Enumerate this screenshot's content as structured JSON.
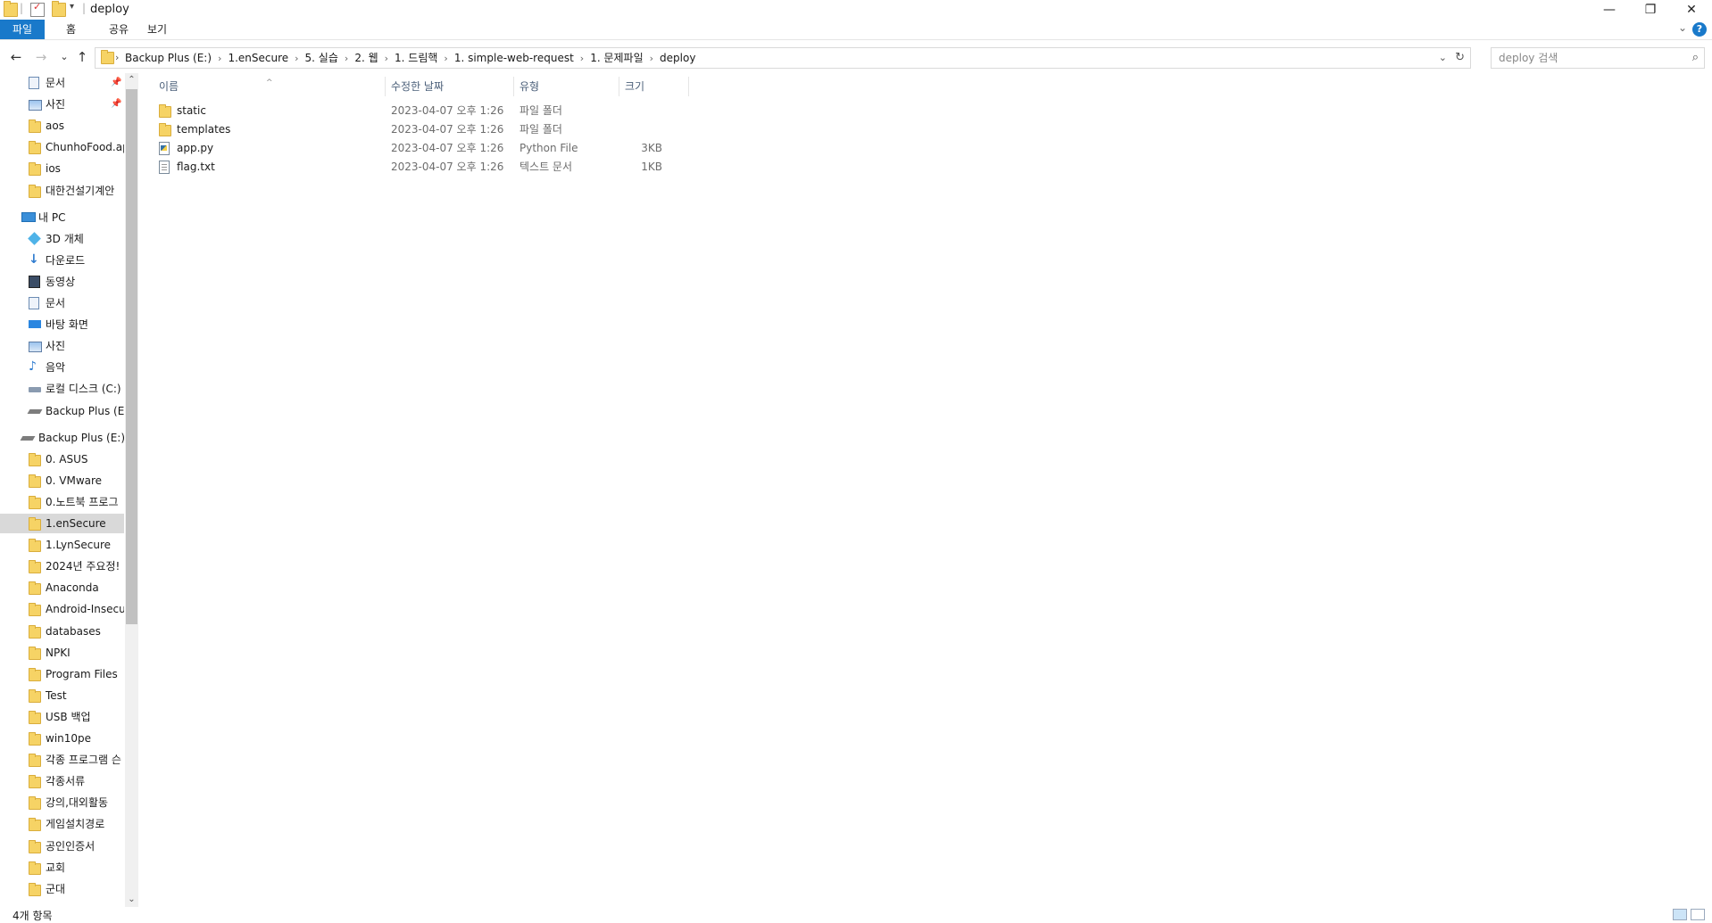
{
  "window": {
    "title": "deploy",
    "minimize": "—",
    "maximize": "❐",
    "close": "✕"
  },
  "ribbon": {
    "tabs": [
      "파일",
      "홈",
      "공유",
      "보기"
    ],
    "help": "?",
    "collapse": "⌄"
  },
  "nav": {
    "back": "←",
    "forward": "→",
    "recent": "⌄",
    "up": "↑"
  },
  "address": {
    "crumbs": [
      "Backup Plus (E:)",
      "1.enSecure",
      "5. 실습",
      "2. 웹",
      "1. 드림핵",
      "1. simple-web-request",
      "1. 문제파일",
      "deploy"
    ],
    "search_placeholder": "deploy 검색"
  },
  "sidebar": {
    "items": [
      {
        "label": "문서",
        "icon": "document-icon",
        "pinned": true
      },
      {
        "label": "사진",
        "icon": "pictures-icon",
        "pinned": true
      },
      {
        "label": "aos",
        "icon": "folder-icon"
      },
      {
        "label": "ChunhoFood.ap",
        "icon": "folder-icon"
      },
      {
        "label": "ios",
        "icon": "folder-icon"
      },
      {
        "label": "대한건설기계안",
        "icon": "folder-icon"
      },
      {
        "label": "내 PC",
        "icon": "pc-icon",
        "top": true
      },
      {
        "label": "3D 개체",
        "icon": "3d-objects-icon"
      },
      {
        "label": "다운로드",
        "icon": "download-icon"
      },
      {
        "label": "동영상",
        "icon": "video-icon"
      },
      {
        "label": "문서",
        "icon": "document-icon"
      },
      {
        "label": "바탕 화면",
        "icon": "desktop-icon"
      },
      {
        "label": "사진",
        "icon": "pictures-icon"
      },
      {
        "label": "음악",
        "icon": "music-icon"
      },
      {
        "label": "로컬 디스크 (C:)",
        "icon": "local-disk-icon"
      },
      {
        "label": "Backup Plus (E:)",
        "icon": "drive-icon"
      },
      {
        "label": "Backup Plus (E:)",
        "icon": "drive-icon",
        "top": true
      },
      {
        "label": "0. ASUS",
        "icon": "folder-icon"
      },
      {
        "label": "0. VMware",
        "icon": "folder-icon"
      },
      {
        "label": "0.노트북 프로그",
        "icon": "folder-icon"
      },
      {
        "label": "1.enSecure",
        "icon": "folder-icon",
        "selected": true
      },
      {
        "label": "1.LynSecure",
        "icon": "folder-icon"
      },
      {
        "label": "2024년 주요정!",
        "icon": "folder-icon"
      },
      {
        "label": "Anaconda",
        "icon": "folder-icon"
      },
      {
        "label": "Android-Insecur",
        "icon": "folder-icon"
      },
      {
        "label": "databases",
        "icon": "folder-icon"
      },
      {
        "label": "NPKI",
        "icon": "folder-icon"
      },
      {
        "label": "Program Files",
        "icon": "folder-icon"
      },
      {
        "label": "Test",
        "icon": "folder-icon"
      },
      {
        "label": "USB 백업",
        "icon": "folder-icon"
      },
      {
        "label": "win10pe",
        "icon": "folder-icon"
      },
      {
        "label": "각종 프로그램 슨",
        "icon": "folder-icon"
      },
      {
        "label": "각종서류",
        "icon": "folder-icon"
      },
      {
        "label": "강의,대외활동",
        "icon": "folder-icon"
      },
      {
        "label": "게임설치경로",
        "icon": "folder-icon"
      },
      {
        "label": "공인인증서",
        "icon": "folder-icon"
      },
      {
        "label": "교회",
        "icon": "folder-icon"
      },
      {
        "label": "군대",
        "icon": "folder-icon"
      }
    ]
  },
  "columns": {
    "name": "이름",
    "date": "수정한 날짜",
    "type": "유형",
    "size": "크기"
  },
  "files": [
    {
      "name": "static",
      "date": "2023-04-07 오후 1:26",
      "type": "파일 폴더",
      "size": "",
      "icon": "folder-icon"
    },
    {
      "name": "templates",
      "date": "2023-04-07 오후 1:26",
      "type": "파일 폴더",
      "size": "",
      "icon": "folder-icon"
    },
    {
      "name": "app.py",
      "date": "2023-04-07 오후 1:26",
      "type": "Python File",
      "size": "3KB",
      "icon": "python-file-icon"
    },
    {
      "name": "flag.txt",
      "date": "2023-04-07 오후 1:26",
      "type": "텍스트 문서",
      "size": "1KB",
      "icon": "text-file-icon"
    }
  ],
  "status": {
    "count": "4개 항목"
  },
  "colors": {
    "accent": "#1979ca",
    "folder": "#f6d365",
    "selected": "#d9d9d9"
  }
}
